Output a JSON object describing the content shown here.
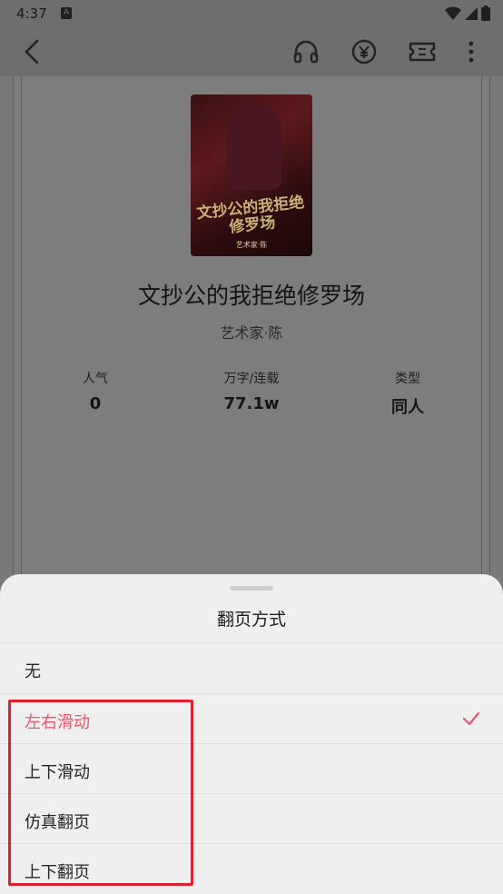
{
  "status_bar": {
    "time": "4:37",
    "a_badge": "A"
  },
  "app_bar": {
    "icons": [
      "back-icon",
      "headphones-icon",
      "yuan-coin-icon",
      "ticket-icon",
      "more-icon"
    ]
  },
  "book": {
    "cover_title": "文抄公的我拒绝修罗场",
    "cover_author": "艺术家·陈",
    "title": "文抄公的我拒绝修罗场",
    "author": "艺术家·陈",
    "stats": [
      {
        "label": "人气",
        "value": "0"
      },
      {
        "label": "万字/连载",
        "value": "77.1w"
      },
      {
        "label": "类型",
        "value": "同人"
      }
    ]
  },
  "sheet": {
    "title": "翻页方式",
    "options": [
      {
        "label": "无",
        "selected": false
      },
      {
        "label": "左右滑动",
        "selected": true
      },
      {
        "label": "上下滑动",
        "selected": false
      },
      {
        "label": "仿真翻页",
        "selected": false
      },
      {
        "label": "上下翻页",
        "selected": false
      }
    ]
  },
  "colors": {
    "accent": "#e8546d",
    "highlight": "#e0202f",
    "scrim": "#7a7a7a",
    "sheet": "#efefef"
  }
}
